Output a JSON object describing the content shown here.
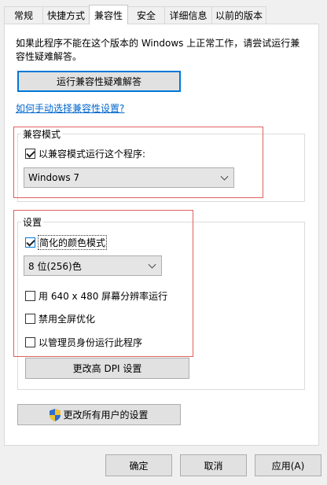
{
  "tabs": [
    {
      "label": "常规"
    },
    {
      "label": "快捷方式"
    },
    {
      "label": "兼容性"
    },
    {
      "label": "安全"
    },
    {
      "label": "详细信息"
    },
    {
      "label": "以前的版本"
    }
  ],
  "intro_text": "如果此程序不能在这个版本的 Windows 上正常工作，请尝试运行兼容性疑难解答。",
  "troubleshoot_button": "运行兼容性疑难解答",
  "manual_link": "如何手动选择兼容性设置?",
  "compat_mode": {
    "title": "兼容模式",
    "checkbox_label": "以兼容模式运行这个程序:",
    "checked": true,
    "selected_os": "Windows 7"
  },
  "settings": {
    "title": "设置",
    "reduced_color": {
      "label": "简化的颜色模式",
      "checked": true
    },
    "color_depth": "8 位(256)色",
    "run_640": {
      "label": "用 640 x 480 屏幕分辨率运行",
      "checked": false
    },
    "disable_fullscreen": {
      "label": "禁用全屏优化",
      "checked": false
    },
    "run_admin": {
      "label": "以管理员身份运行此程序",
      "checked": false
    },
    "dpi_button": "更改高 DPI 设置"
  },
  "all_users_button": "更改所有用户的设置",
  "footer": {
    "ok": "确定",
    "cancel": "取消",
    "apply": "应用(A)"
  },
  "colors": {
    "accent": "#0078d7",
    "link": "#0066cc",
    "highlight_box": "#e06060"
  }
}
